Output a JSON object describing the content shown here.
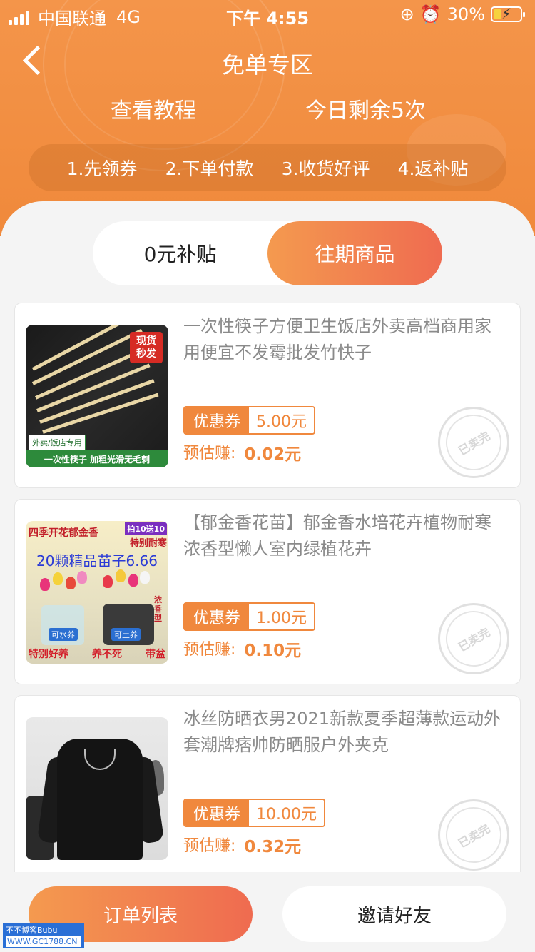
{
  "status_bar": {
    "carrier": "中国联通",
    "network": "4G",
    "time": "下午 4:55",
    "battery": "30%",
    "battery_level": 0.3
  },
  "nav": {
    "title": "免单专区",
    "back_icon": "chevron-left-icon"
  },
  "links": {
    "tutorial": "查看教程",
    "remaining": "今日剩余5次"
  },
  "steps": [
    "1.先领券",
    "2.下单付款",
    "3.收货好评",
    "4.返补贴"
  ],
  "tabs": [
    {
      "label": "0元补贴",
      "active": false
    },
    {
      "label": "往期商品",
      "active": true
    }
  ],
  "products": [
    {
      "title": "一次性筷子方便卫生饭店外卖高档商用家用便宜不发霉批发竹快子",
      "coupon_label": "优惠券",
      "coupon_value": "5.00元",
      "earn_label": "预估赚:",
      "earn_value": "0.02元",
      "stamp": "已卖完",
      "image": {
        "tag": "现货\n秒发",
        "badge1": "外卖/饭店专用",
        "badge2": "一次性筷子 加粗光滑无毛刺"
      }
    },
    {
      "title": "【郁金香花苗】郁金香水培花卉植物耐寒浓香型懒人室内绿植花卉",
      "coupon_label": "优惠券",
      "coupon_value": "1.00元",
      "earn_label": "预估赚:",
      "earn_value": "0.10元",
      "stamp": "已卖完",
      "image": {
        "t1": "四季开花郁金香",
        "t2": "拍10送10",
        "t3": "特别耐寒",
        "t4": "20颗精品苗子6.66",
        "l1": "可水养",
        "l2": "可土养",
        "side": "浓香型",
        "b1": "特别好养",
        "b2": "养不死",
        "b3": "带盆"
      }
    },
    {
      "title": "冰丝防晒衣男2021新款夏季超薄款运动外套潮牌痞帅防晒服户外夹克",
      "coupon_label": "优惠券",
      "coupon_value": "10.00元",
      "earn_label": "预估赚:",
      "earn_value": "0.32元",
      "stamp": "已卖完"
    }
  ],
  "bottom": {
    "orders": "订单列表",
    "invite": "邀请好友"
  },
  "watermark": {
    "line1": "不不博客Bubu",
    "line2": "WWW.GC1788.CN"
  },
  "colors": {
    "accent": "#f0883d",
    "gradient_start": "#f49a4f",
    "gradient_end": "#ef6b50"
  }
}
